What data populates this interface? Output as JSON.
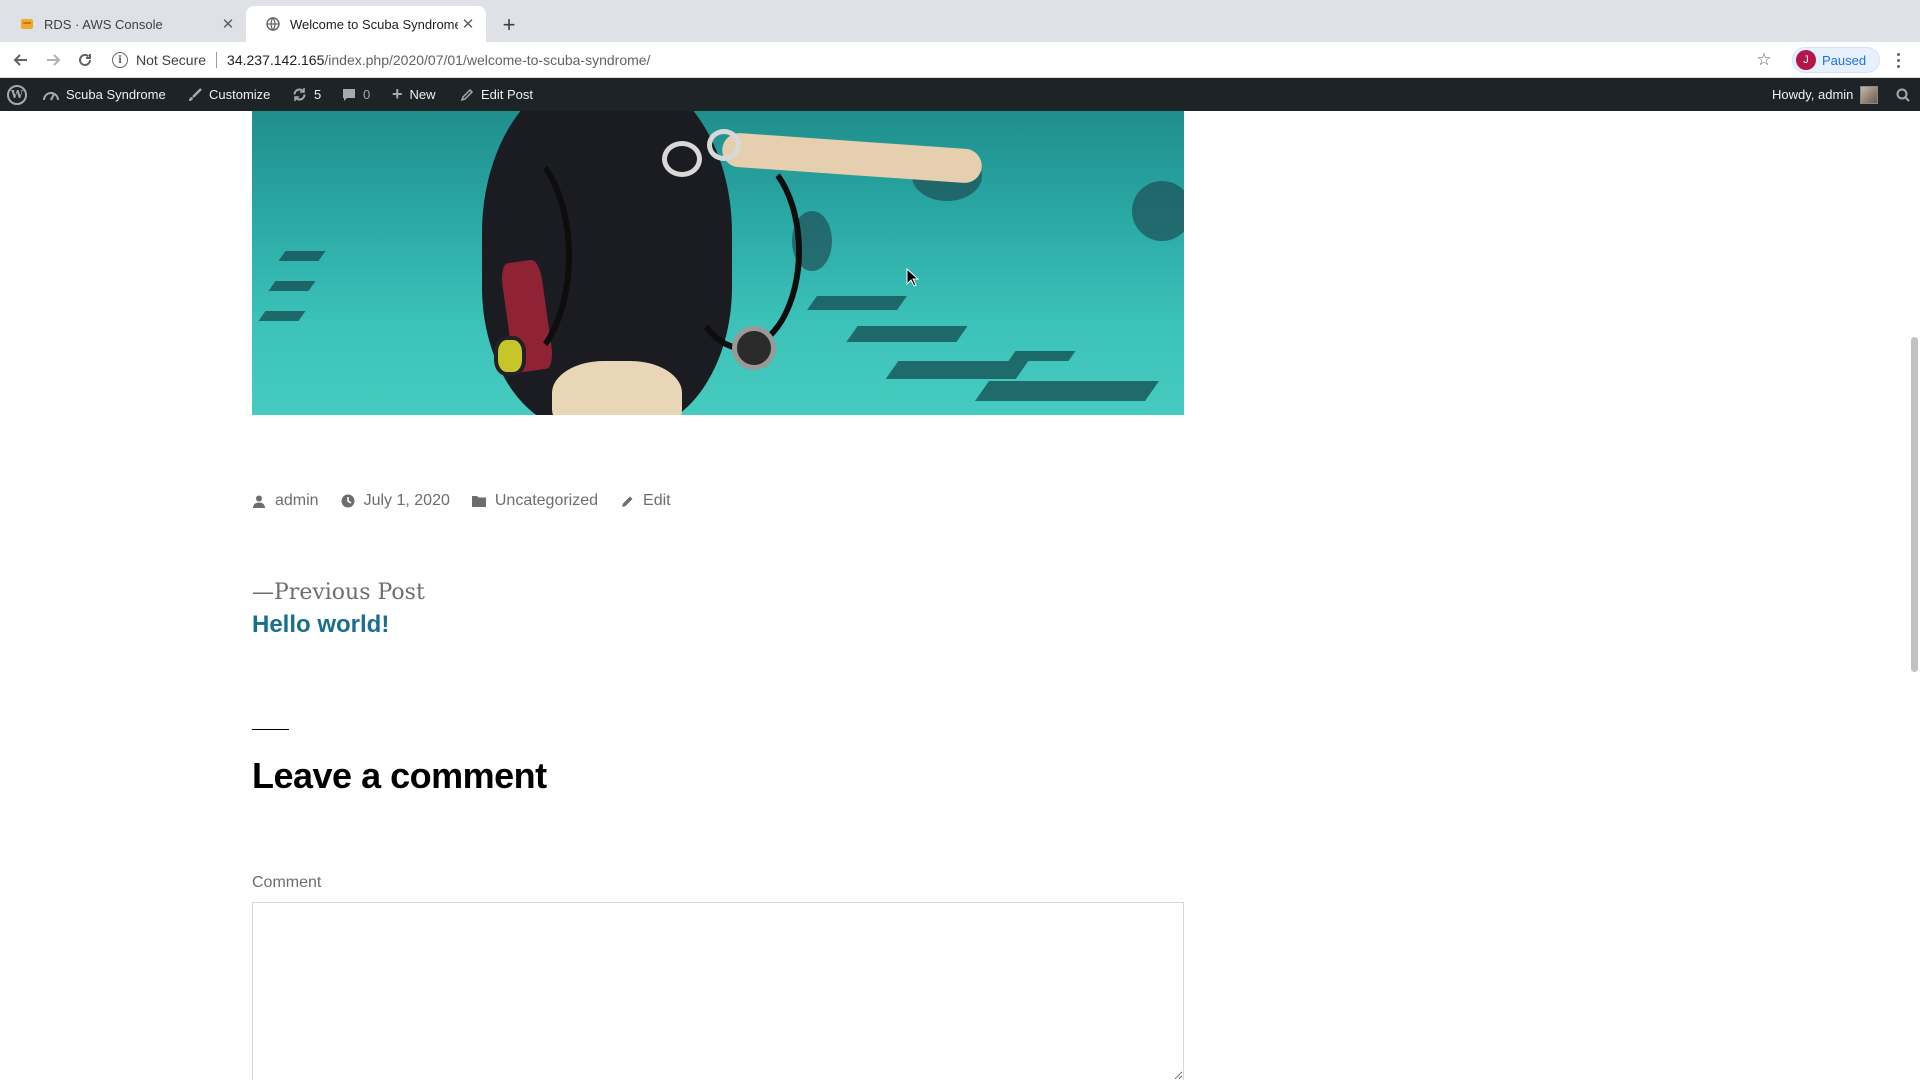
{
  "browser": {
    "tabs": [
      {
        "title": "RDS · AWS Console",
        "favicon": "aws-icon",
        "active": false
      },
      {
        "title": "Welcome to Scuba Syndrome",
        "favicon": "globe-icon",
        "active": true
      }
    ],
    "new_tab": "+",
    "address": {
      "security_label": "Not Secure",
      "host": "34.237.142.165",
      "path": "/index.php/2020/07/01/welcome-to-scuba-syndrome/"
    },
    "profile": {
      "initial": "J",
      "status": "Paused"
    }
  },
  "admin_bar": {
    "site_name": "Scuba Syndrome",
    "customize": "Customize",
    "updates_count": "5",
    "comments_count": "0",
    "new": "New",
    "edit_post": "Edit Post",
    "howdy": "Howdy, admin"
  },
  "post": {
    "meta": {
      "author": "admin",
      "date": "July 1, 2020",
      "category": "Uncategorized",
      "edit": "Edit"
    },
    "navigation": {
      "previous_label": "—Previous Post",
      "previous_title": "Hello world!"
    }
  },
  "comments": {
    "heading": "Leave a comment",
    "comment_label": "Comment",
    "comment_value": ""
  },
  "colors": {
    "admin_bar_bg": "#1d2327",
    "link": "#1a6e8e",
    "meta_text": "#6d6d6d"
  }
}
